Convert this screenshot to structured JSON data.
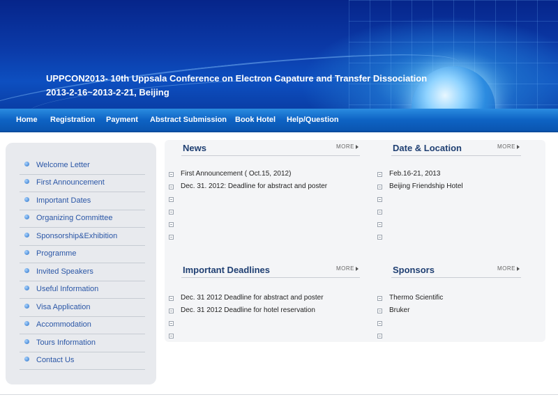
{
  "banner": {
    "title_line1": "UPPCON2013- 10th Uppsala Conference on Electron Capature and Transfer Dissociation",
    "title_line2": "2013-2-16~2013-2-21, Beijing"
  },
  "nav": {
    "items": [
      "Home",
      "Registration",
      "Payment",
      "Abstract Submission",
      "Book Hotel",
      "Help/Question"
    ]
  },
  "sidebar": {
    "items": [
      "Welcome Letter",
      "First Announcement",
      "Important Dates",
      "Organizing Committee",
      "Sponsorship&Exhibition",
      "Programme",
      "Invited Speakers",
      "Useful Information",
      "Visa Application",
      "Accommodation",
      "Tours Information",
      "Contact Us"
    ]
  },
  "more_label": "MORE",
  "panels": {
    "news": {
      "title": "News",
      "rows": [
        "First Announcement ( Oct.15, 2012)",
        "Dec. 31. 2012: Deadline for abstract and poster",
        "",
        "",
        "",
        ""
      ]
    },
    "date_location": {
      "title": "Date & Location",
      "rows": [
        "Feb.16-21, 2013",
        "Beijing Friendship Hotel",
        "",
        "",
        "",
        ""
      ]
    },
    "deadlines": {
      "title": "Important Deadlines",
      "rows": [
        "Dec. 31 2012 Deadline for abstract and poster",
        "Dec. 31 2012 Deadline for hotel reservation",
        "",
        ""
      ]
    },
    "sponsors": {
      "title": "Sponsors",
      "rows": [
        "Thermo Scientific",
        "Bruker",
        "",
        ""
      ]
    }
  },
  "colors": {
    "nav_blue": "#0e63c4",
    "banner_dark": "#06258a",
    "sidebar_text": "#2a56a6",
    "panel_title": "#1f3f72"
  }
}
